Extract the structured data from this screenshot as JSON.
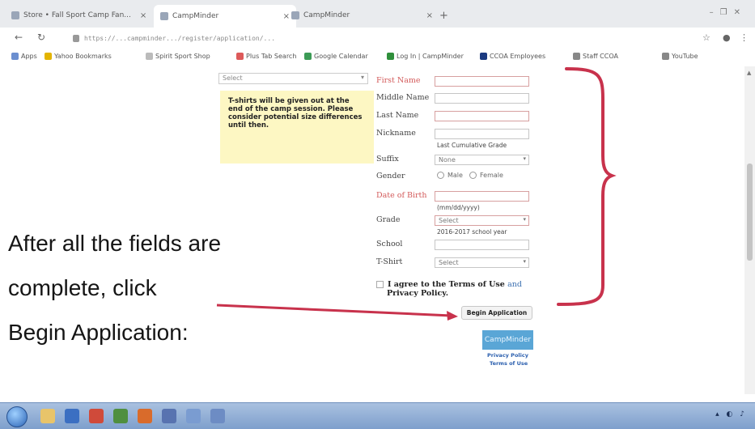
{
  "browser": {
    "tabs": [
      {
        "title": "Store • Fall Sport Camp Fan..."
      },
      {
        "title": "CampMinder"
      },
      {
        "title": "CampMinder"
      }
    ],
    "address": "https://...campminder.../register/application/...",
    "bookmarks": [
      {
        "label": "Apps",
        "color": "#6c8fd0"
      },
      {
        "label": "Yahoo Bookmarks",
        "color": "#e3b400"
      },
      {
        "label": "Spirit Sport Shop",
        "color": "#bbbbbb"
      },
      {
        "label": "Plus Tab Search",
        "color": "#dd5a5a"
      },
      {
        "label": "Google Calendar",
        "color": "#3c9b56"
      },
      {
        "label": "Log In | CampMinder",
        "color": "#2f8f3b"
      },
      {
        "label": "CCOA Employees",
        "color": "#1b3a80"
      },
      {
        "label": "Staff CCOA",
        "color": "#888888"
      },
      {
        "label": "YouTube",
        "color": "#888888"
      }
    ]
  },
  "form": {
    "top_select_value": "Select",
    "note": "T-shirts will be given out at the end of the camp session. Please consider potential size differences until then.",
    "first_name_label": "First Name",
    "middle_name_label": "Middle Name",
    "last_name_label": "Last Name",
    "nickname_label": "Nickname",
    "nickname_hint": "Last Cumulative Grade",
    "suffix_label": "Suffix",
    "suffix_value": "None",
    "gender_label": "Gender",
    "gender_male": "Male",
    "gender_female": "Female",
    "dob_label": "Date of Birth",
    "dob_hint": "(mm/dd/yyyy)",
    "grade_label": "Grade",
    "grade_value": "Select",
    "grade_hint": "2016-2017 school year",
    "school_label": "School",
    "tshirt_label": "T-Shirt",
    "tshirt_value": "Select",
    "terms_prefix": "I agree to the",
    "terms_link": "Terms of Use",
    "terms_and": "and",
    "privacy_link": "Privacy Policy.",
    "begin_button": "Begin Application",
    "brand_box": "CampMinder",
    "privacy_footer": "Privacy Policy",
    "terms_footer": "Terms of Use"
  },
  "instruction": {
    "line1": "After all the fields are",
    "line2": "complete, click",
    "line3": "Begin Application:"
  },
  "annotation_color": "#c8324c"
}
